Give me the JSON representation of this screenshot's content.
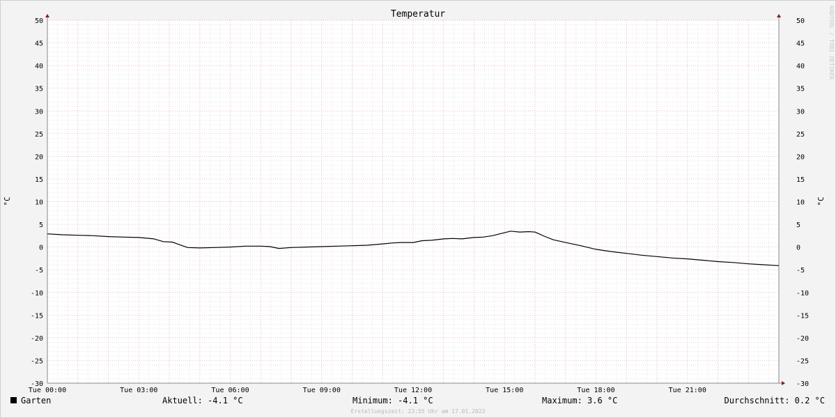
{
  "chart_data": {
    "type": "line",
    "title": "Temperatur",
    "ylabel": "°C",
    "ylim": [
      -30,
      50
    ],
    "yticks": [
      50,
      45,
      40,
      35,
      30,
      25,
      20,
      15,
      10,
      5,
      0,
      -5,
      -10,
      -15,
      -20,
      -25,
      -30
    ],
    "xlim": [
      0,
      24
    ],
    "xticks": [
      {
        "x": 0,
        "label": "Tue 00:00"
      },
      {
        "x": 3,
        "label": "Tue 03:00"
      },
      {
        "x": 6,
        "label": "Tue 06:00"
      },
      {
        "x": 9,
        "label": "Tue 09:00"
      },
      {
        "x": 12,
        "label": "Tue 12:00"
      },
      {
        "x": 15,
        "label": "Tue 15:00"
      },
      {
        "x": 18,
        "label": "Tue 18:00"
      },
      {
        "x": 21,
        "label": "Tue 21:00"
      }
    ],
    "grid": true,
    "series": [
      {
        "name": "Garten",
        "color": "#000000",
        "x": [
          0,
          0.5,
          1,
          1.5,
          2,
          2.5,
          3,
          3.5,
          3.8,
          4.1,
          4.3,
          4.6,
          5,
          5.5,
          6,
          6.5,
          7,
          7.3,
          7.6,
          8,
          8.5,
          9,
          9.5,
          10,
          10.5,
          11,
          11.3,
          11.6,
          12,
          12.3,
          12.6,
          13,
          13.3,
          13.6,
          14,
          14.3,
          14.6,
          14.9,
          15.2,
          15.5,
          15.8,
          16,
          16.3,
          16.6,
          17,
          17.5,
          18,
          18.5,
          19,
          19.5,
          20,
          20.5,
          21,
          21.5,
          22,
          22.5,
          23,
          23.5,
          24
        ],
        "values": [
          2.9,
          2.7,
          2.6,
          2.5,
          2.3,
          2.2,
          2.1,
          1.8,
          1.2,
          1.1,
          0.6,
          -0.1,
          -0.2,
          -0.1,
          0,
          0.2,
          0.2,
          0.1,
          -0.3,
          -0.1,
          0,
          0.1,
          0.2,
          0.3,
          0.4,
          0.7,
          0.9,
          1.0,
          1.0,
          1.4,
          1.5,
          1.8,
          1.9,
          1.8,
          2.1,
          2.2,
          2.5,
          3.0,
          3.5,
          3.3,
          3.4,
          3.3,
          2.4,
          1.6,
          1.0,
          0.3,
          -0.5,
          -1.0,
          -1.4,
          -1.8,
          -2.1,
          -2.4,
          -2.6,
          -2.9,
          -3.2,
          -3.4,
          -3.7,
          -3.9,
          -4.1
        ]
      }
    ],
    "legend": [
      {
        "name": "Garten",
        "color": "#000000"
      }
    ]
  },
  "stats": {
    "current": "Aktuell: -4.1 °C",
    "minimum": "Minimum: -4.1 °C",
    "maximum": "Maximum: 3.6 °C",
    "average": "Durchschnitt: 0.2 °C"
  },
  "footer": "Erstellungszeit: 23:55 Uhr am 17.01.2023",
  "watermark": "RRDTOOL / TOBI OETIKER",
  "colors": {
    "background": "#f3f3f3",
    "plot_background": "#ffffff",
    "major_grid": "#e8a0a8",
    "minor_grid": "#d4d4d4",
    "axis": "#888888",
    "arrow": "#8b1a1a"
  }
}
